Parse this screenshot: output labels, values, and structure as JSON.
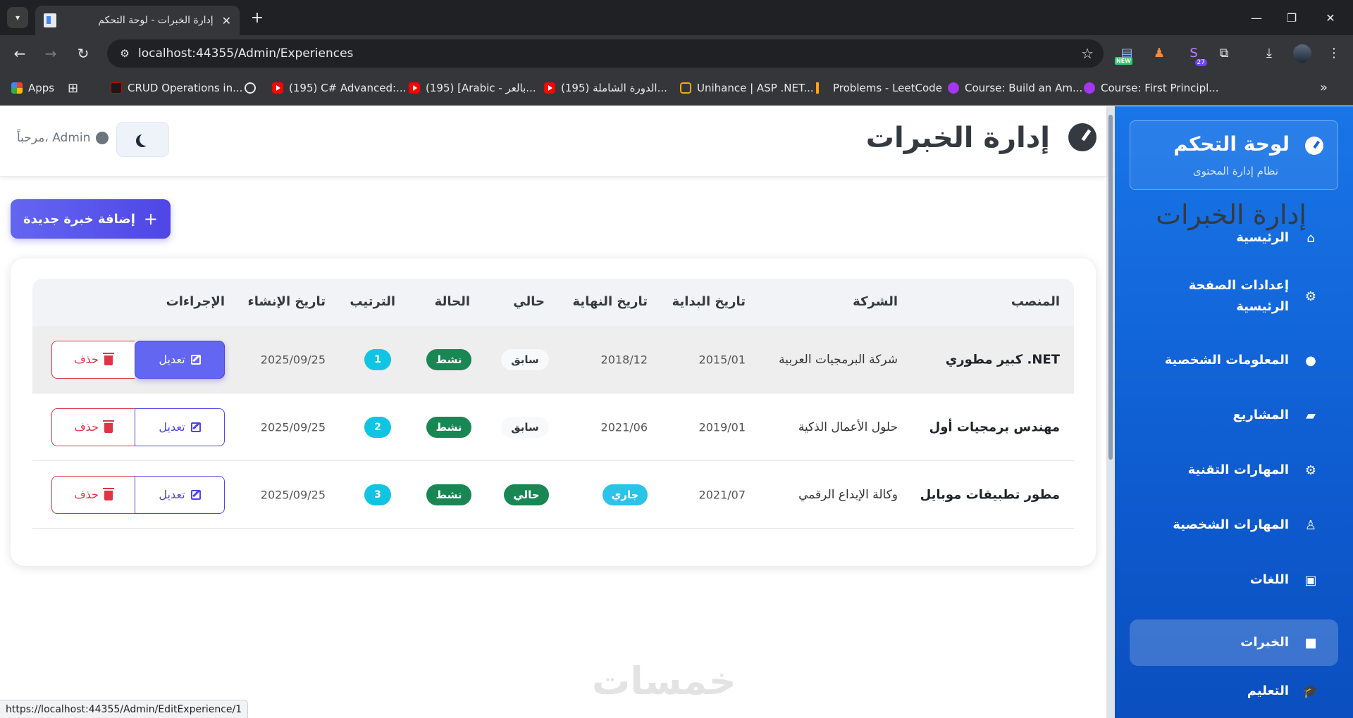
{
  "browser": {
    "tab_title": "إدارة الخبرات - لوحة التحكم",
    "url": "localhost:44355/Admin/Experiences",
    "status_url": "https://localhost:44355/Admin/EditExperience/1",
    "ext_badge_new": "NEW",
    "ext_badge_count": "27",
    "bookmarks": [
      {
        "label": "Apps",
        "icon": "apps-grid-icon"
      },
      {
        "label": "CRUD Operations in...",
        "icon": "crud-favicon"
      },
      {
        "label": "(195) C# Advanced:...",
        "icon": "youtube-icon"
      },
      {
        "label": "(195) [Arabic - بالعر...",
        "icon": "youtube-icon"
      },
      {
        "label": "(195) الدورة الشاملة...",
        "icon": "youtube-icon"
      },
      {
        "label": "Unihance | ASP .NET...",
        "icon": "unihance-icon"
      },
      {
        "label": "Problems - LeetCode",
        "icon": "leetcode-icon"
      },
      {
        "label": "Course: Build an Am...",
        "icon": "udemy-icon"
      },
      {
        "label": "Course: First Principl...",
        "icon": "udemy-icon"
      }
    ]
  },
  "header": {
    "title": "إدارة الخبرات",
    "welcome": "مرحباً، Admin"
  },
  "sidebar": {
    "brand_title": "لوحة التحكم",
    "brand_subtitle": "نظام إدارة المحتوى",
    "items": [
      {
        "label": "الرئيسية",
        "icon": "home-icon",
        "active": false
      },
      {
        "label": "إعدادات الصفحة الرئيسية",
        "icon": "gear-icon",
        "active": false
      },
      {
        "label": "المعلومات الشخصية",
        "icon": "user-icon",
        "active": false
      },
      {
        "label": "المشاريع",
        "icon": "folder-icon",
        "active": false
      },
      {
        "label": "المهارات التقنية",
        "icon": "gears-icon",
        "active": false
      },
      {
        "label": "المهارات الشخصية",
        "icon": "user-tie-icon",
        "active": false
      },
      {
        "label": "اللغات",
        "icon": "language-icon",
        "active": false
      },
      {
        "label": "الخبرات",
        "icon": "briefcase-icon",
        "active": true
      },
      {
        "label": "التعليم",
        "icon": "graduation-cap-icon",
        "active": false
      }
    ]
  },
  "main": {
    "title": "إدارة الخبرات",
    "add_button": "إضافة خبرة جديدة",
    "columns": {
      "position": "المنصب",
      "company": "الشركة",
      "start": "تاريخ البداية",
      "end": "تاريخ النهاية",
      "current": "حالي",
      "status": "الحالة",
      "order": "الترتيب",
      "created": "تاريخ الإنشاء",
      "actions": "الإجراءات"
    },
    "rows": [
      {
        "position": "كبير مطوري .NET",
        "company": "شركة البرمجيات العربية",
        "start": "2015/01",
        "end": "2018/12",
        "current": "سابق",
        "status": "نشط",
        "order": "1",
        "created": "2025/09/25"
      },
      {
        "position": "مهندس برمجيات أول",
        "company": "حلول الأعمال الذكية",
        "start": "2019/01",
        "end": "2021/06",
        "current": "سابق",
        "status": "نشط",
        "order": "2",
        "created": "2025/09/25"
      },
      {
        "position": "مطور تطبيقات موبايل",
        "company": "وكالة الإبداع الرقمي",
        "start": "2021/07",
        "end": "جاري",
        "current": "حالي",
        "status": "نشط",
        "order": "3",
        "created": "2025/09/25"
      }
    ],
    "edit_label": "تعديل",
    "delete_label": "حذف"
  },
  "watermark": "خمسات",
  "colors": {
    "sidebar": "#1565d8",
    "primary": "#4f46e5",
    "success": "#198754",
    "info": "#12c4e3",
    "danger": "#dc3545"
  }
}
